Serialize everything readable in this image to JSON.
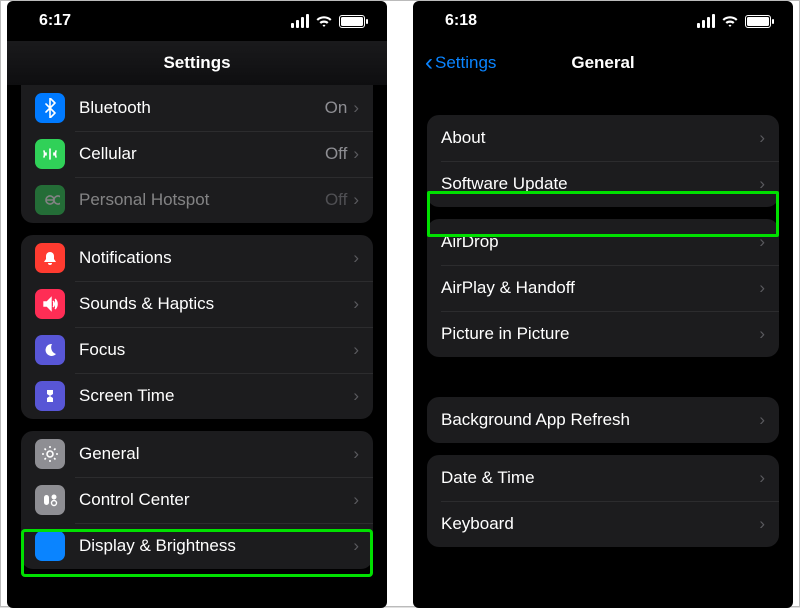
{
  "left": {
    "status_time": "6:17",
    "title": "Settings",
    "group1": [
      {
        "key": "bluetooth",
        "label": "Bluetooth",
        "value": "On",
        "icon_name": "bluetooth-icon",
        "bg": "#007aff"
      },
      {
        "key": "cellular",
        "label": "Cellular",
        "value": "Off",
        "icon_name": "cellular-icon",
        "bg": "#30d158"
      },
      {
        "key": "hotspot",
        "label": "Personal Hotspot",
        "value": "Off",
        "icon_name": "hotspot-icon",
        "bg": "#30d158",
        "disabled": true
      }
    ],
    "group2": [
      {
        "key": "notifications",
        "label": "Notifications",
        "icon_name": "notifications-icon",
        "bg": "#ff3b30"
      },
      {
        "key": "sounds",
        "label": "Sounds & Haptics",
        "icon_name": "sounds-icon",
        "bg": "#ff2d55"
      },
      {
        "key": "focus",
        "label": "Focus",
        "icon_name": "focus-icon",
        "bg": "#5856d6"
      },
      {
        "key": "screentime",
        "label": "Screen Time",
        "icon_name": "screentime-icon",
        "bg": "#5856d6"
      }
    ],
    "group3": [
      {
        "key": "general",
        "label": "General",
        "icon_name": "general-icon",
        "bg": "#8e8e93"
      },
      {
        "key": "controlcenter",
        "label": "Control Center",
        "icon_name": "control-center-icon",
        "bg": "#8e8e93"
      },
      {
        "key": "display",
        "label": "Display & Brightness",
        "icon_name": "display-icon",
        "bg": "#0a84ff"
      }
    ]
  },
  "right": {
    "status_time": "6:18",
    "back_label": "Settings",
    "title": "General",
    "group1": [
      {
        "key": "about",
        "label": "About"
      },
      {
        "key": "update",
        "label": "Software Update"
      }
    ],
    "group2": [
      {
        "key": "airdrop",
        "label": "AirDrop"
      },
      {
        "key": "airplay",
        "label": "AirPlay & Handoff"
      },
      {
        "key": "pip",
        "label": "Picture in Picture"
      }
    ],
    "group3": [
      {
        "key": "bgrefresh",
        "label": "Background App Refresh"
      }
    ],
    "group4": [
      {
        "key": "datetime",
        "label": "Date & Time"
      },
      {
        "key": "keyboard",
        "label": "Keyboard"
      }
    ]
  }
}
